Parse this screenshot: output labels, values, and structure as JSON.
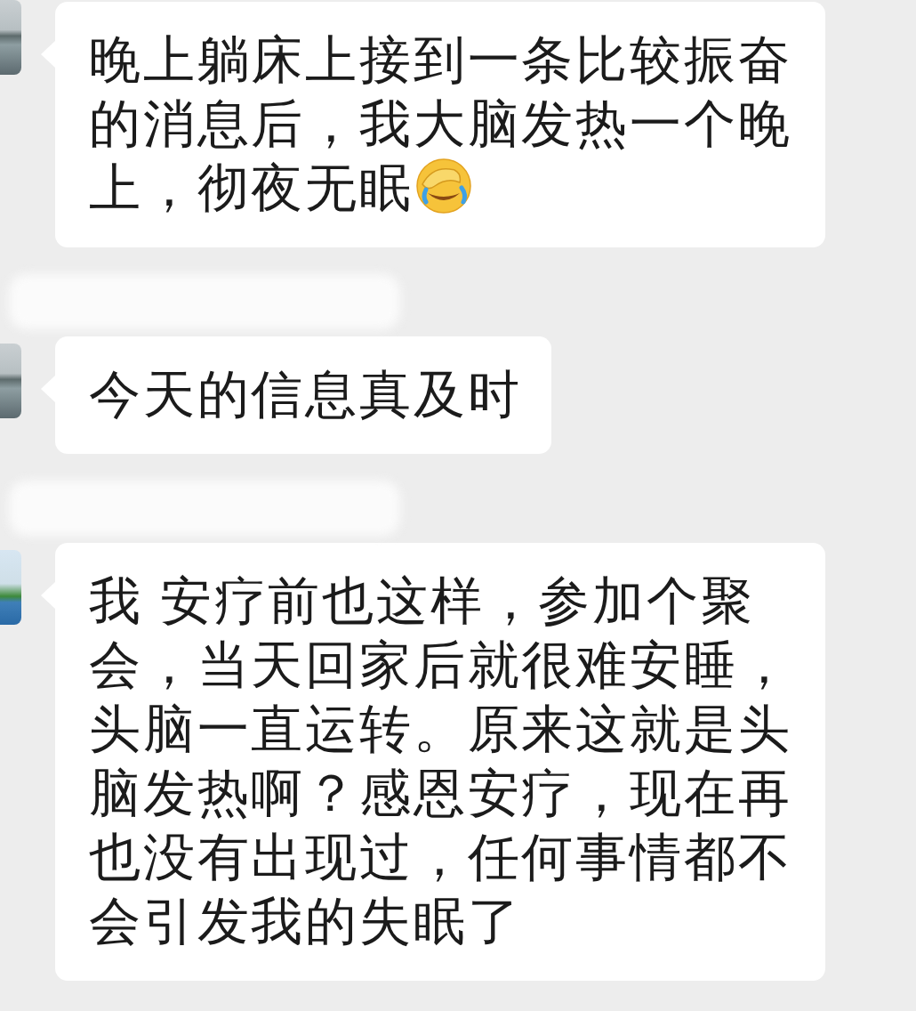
{
  "messages": [
    {
      "text": "晚上躺床上接到一条比较振奋的消息后，我大脑发热一个晚上，彻夜无眠",
      "sender_name_blurred": false,
      "has_emoji": true
    },
    {
      "text": "今天的信息真及时",
      "sender_name_blurred": true,
      "has_emoji": false
    },
    {
      "text": "我 安疗前也这样，参加个聚会，当天回家后就很难安睡，头脑一直运转。原来这就是头脑发热啊？感恩安疗，现在再也没有出现过，任何事情都不会引发我的失眠了",
      "sender_name_blurred": true,
      "has_emoji": false
    }
  ]
}
